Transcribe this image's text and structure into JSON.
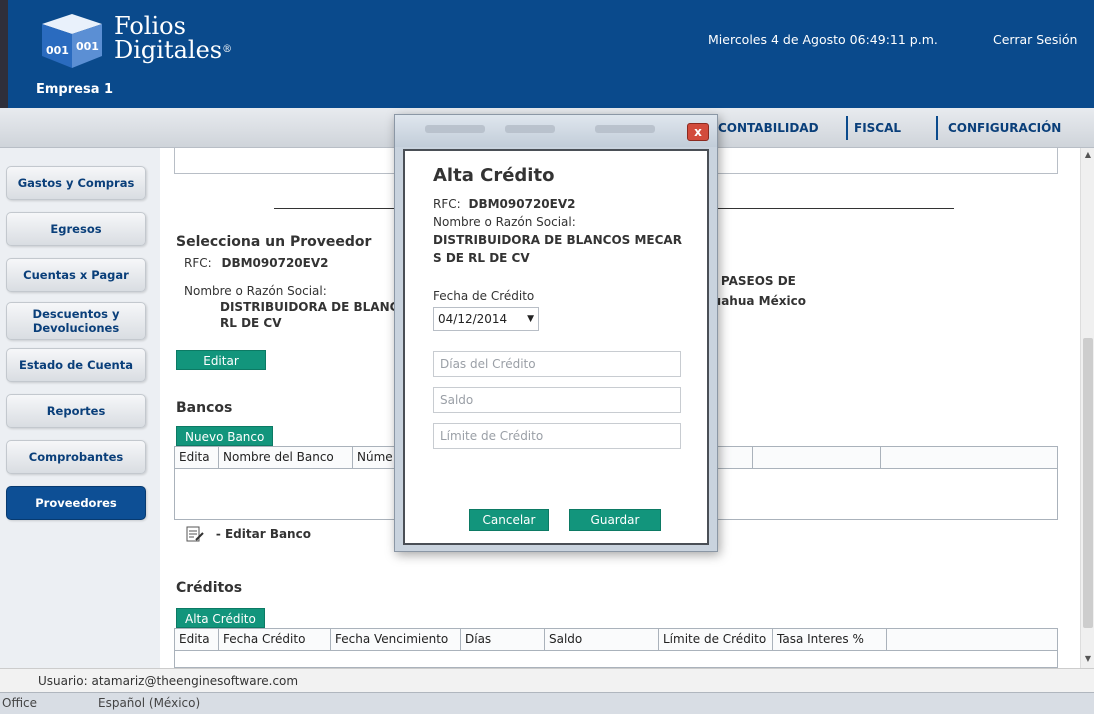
{
  "header": {
    "brand_line1": "Folios",
    "brand_line2": "Digitales",
    "brand_mark": "®",
    "company": "Empresa 1",
    "datetime": "Miercoles 4 de Agosto 06:49:11 p.m.",
    "logout": "Cerrar Sesión"
  },
  "nav": {
    "items": [
      "CONTABILIDAD",
      "FISCAL",
      "CONFIGURACIÓN"
    ]
  },
  "sidebar": {
    "items": [
      {
        "label": "Gastos y Compras"
      },
      {
        "label": "Egresos"
      },
      {
        "label": "Cuentas x Pagar"
      },
      {
        "label": "Descuentos y Devoluciones"
      },
      {
        "label": "Estado de Cuenta"
      },
      {
        "label": "Reportes"
      },
      {
        "label": "Comprobantes"
      },
      {
        "label": "Proveedores"
      }
    ],
    "active": "Proveedores"
  },
  "provider": {
    "section_title": "Selecciona un Proveedor",
    "rfc_label": "RFC:",
    "rfc": "DBM090720EV2",
    "name_label": "Nombre o Razón Social:",
    "name_line1": "DISTRIBUIDORA DE BLANC",
    "name_line2": "RL DE CV",
    "address_line1": "41 PASEOS DE",
    "address_line2": "ihuahua México",
    "edit_button": "Editar"
  },
  "banks": {
    "section_title": "Bancos",
    "new_button": "Nuevo Banco",
    "columns": [
      "Edita",
      "Nombre del Banco",
      "Núme"
    ],
    "edit_note": "- Editar Banco"
  },
  "credits": {
    "section_title": "Créditos",
    "new_button": "Alta Crédito",
    "columns": [
      "Edita",
      "Fecha Crédito",
      "Fecha Vencimiento",
      "Días",
      "Saldo",
      "Límite de Crédito",
      "Tasa Interes %"
    ]
  },
  "modal": {
    "title": "Alta Crédito",
    "rfc_label": "RFC:",
    "rfc": "DBM090720EV2",
    "name_label": "Nombre o Razón Social:",
    "name_line1": "DISTRIBUIDORA DE BLANCOS MECAR",
    "name_line2": "S DE RL DE CV",
    "date_label": "Fecha de Crédito",
    "date_value": "04/12/2014",
    "days_placeholder": "Días del Crédito",
    "balance_placeholder": "Saldo",
    "limit_placeholder": "Límite de Crédito",
    "cancel_button": "Cancelar",
    "save_button": "Guardar",
    "close_glyph": "x"
  },
  "status": {
    "user": "Usuario: atamariz@theenginesoftware.com"
  },
  "taskbar": {
    "item1": "Office",
    "item2": "Español (México)"
  },
  "colors": {
    "header_blue": "#0a4a8c",
    "accent_green": "#12957c",
    "active_tab": "#0d4f95"
  }
}
